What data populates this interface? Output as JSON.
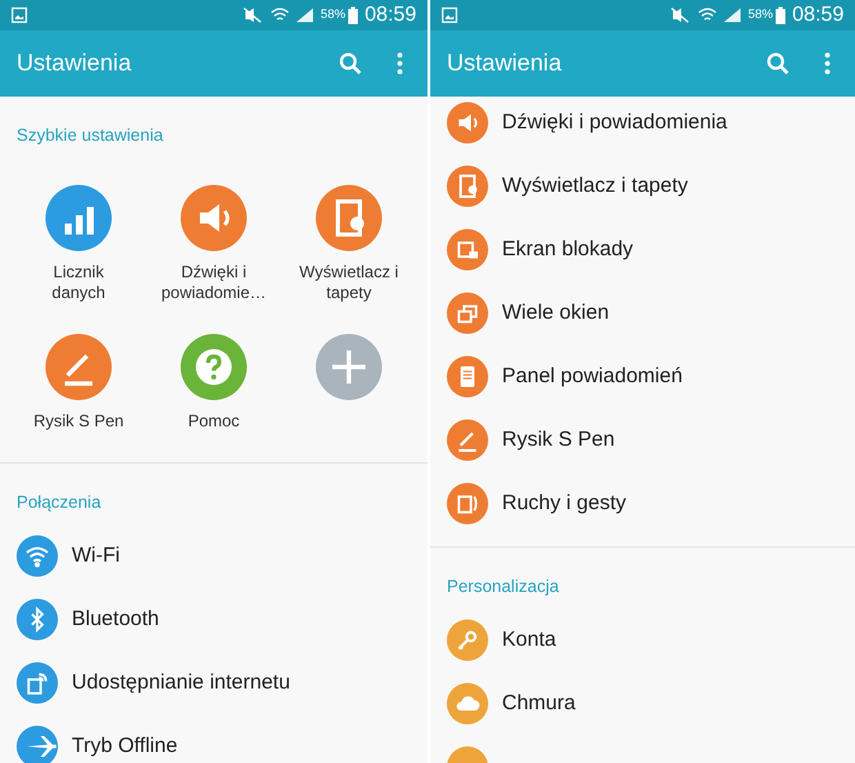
{
  "panels": [
    {
      "status_bar": {
        "battery": "58%",
        "time": "08:59"
      },
      "title": "Ustawienia",
      "sections": [
        {
          "kind": "grid",
          "header": "Szybkie ustawienia",
          "items": [
            {
              "label": "Licznik\ndanych",
              "color": "#2d9be0"
            },
            {
              "label": "Dźwięki i\npowiadomie…",
              "color": "#ee7d33"
            },
            {
              "label": "Wyświetlacz i\ntapety",
              "color": "#ee7d33"
            },
            {
              "label": "Rysik S Pen",
              "color": "#ee7d33"
            },
            {
              "label": "Pomoc",
              "color": "#6ab43a"
            },
            {
              "color": "#a9b4bd"
            }
          ]
        },
        {
          "kind": "list",
          "header": "Połączenia",
          "items": [
            {
              "label": "Wi-Fi",
              "color": "#2d9be0"
            },
            {
              "label": "Bluetooth",
              "color": "#2d9be0"
            },
            {
              "label": "Udostępnianie internetu",
              "color": "#2d9be0"
            },
            {
              "label": "Tryb Offline",
              "color": "#2d9be0"
            }
          ]
        }
      ]
    },
    {
      "status_bar": {
        "battery": "58%",
        "time": "08:59"
      },
      "title": "Ustawienia",
      "sections": [
        {
          "kind": "list",
          "items": [
            {
              "label": "Dźwięki i powiadomienia",
              "color": "#ee7d33"
            },
            {
              "label": "Wyświetlacz i tapety",
              "color": "#ee7d33"
            },
            {
              "label": "Ekran blokady",
              "color": "#ee7d33"
            },
            {
              "label": "Wiele okien",
              "color": "#ee7d33"
            },
            {
              "label": "Panel powiadomień",
              "color": "#ee7d33"
            },
            {
              "label": "Rysik S Pen",
              "color": "#ee7d33"
            },
            {
              "label": "Ruchy i gesty",
              "color": "#ee7d33"
            }
          ]
        },
        {
          "kind": "list",
          "header": "Personalizacja",
          "items": [
            {
              "label": "Konta",
              "color": "#eda53b"
            },
            {
              "label": "Chmura",
              "color": "#eda53b"
            },
            {
              "color": "#eda53b"
            }
          ]
        }
      ]
    }
  ]
}
